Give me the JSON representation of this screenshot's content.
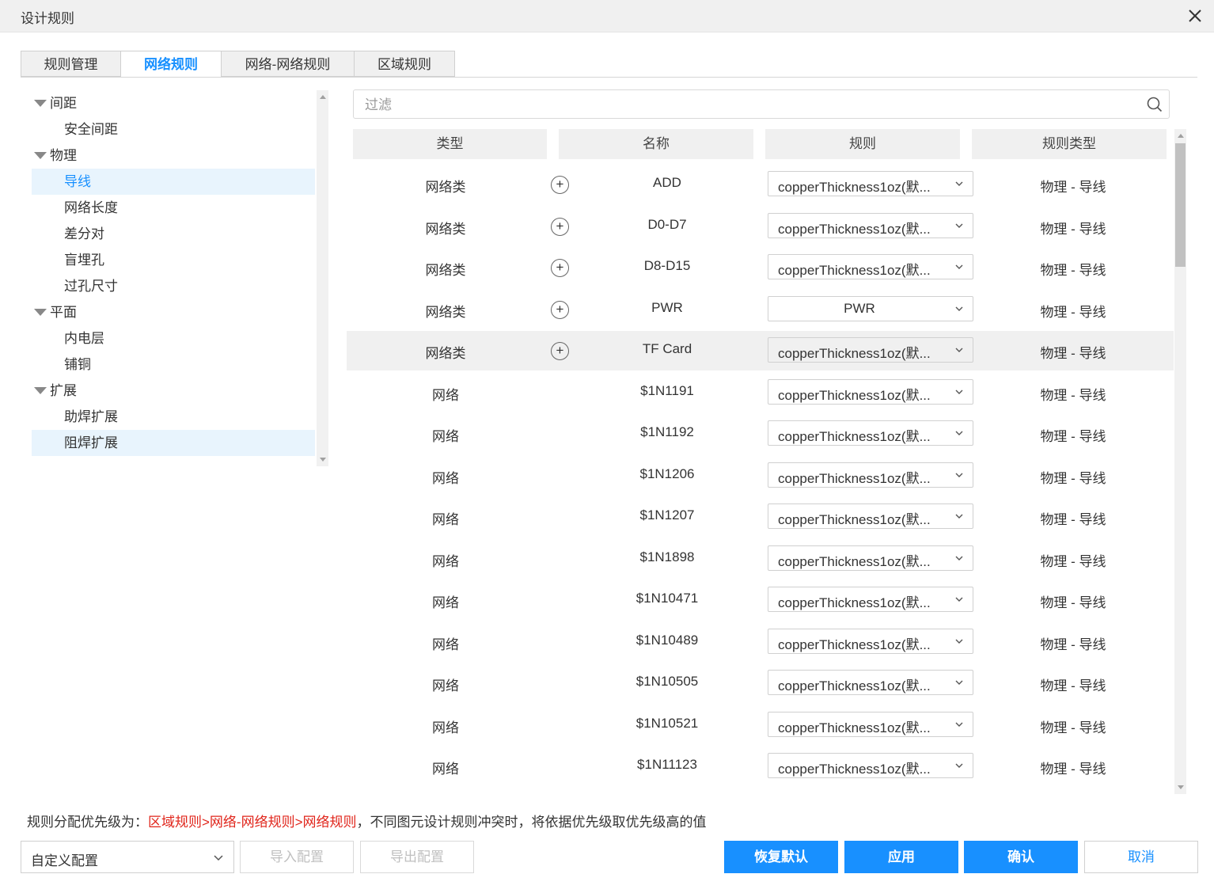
{
  "window": {
    "title": "设计规则"
  },
  "tabs": [
    {
      "label": "规则管理"
    },
    {
      "label": "网络规则"
    },
    {
      "label": "网络-网络规则"
    },
    {
      "label": "区域规则"
    }
  ],
  "tree": {
    "items": [
      {
        "label": "间距"
      },
      {
        "label": "安全间距"
      },
      {
        "label": "物理"
      },
      {
        "label": "导线"
      },
      {
        "label": "网络长度"
      },
      {
        "label": "差分对"
      },
      {
        "label": "盲埋孔"
      },
      {
        "label": "过孔尺寸"
      },
      {
        "label": "平面"
      },
      {
        "label": "内电层"
      },
      {
        "label": "铺铜"
      },
      {
        "label": "扩展"
      },
      {
        "label": "助焊扩展"
      },
      {
        "label": "阻焊扩展"
      }
    ]
  },
  "filter": {
    "placeholder": "过滤",
    "value": ""
  },
  "table": {
    "headers": {
      "type": "类型",
      "name": "名称",
      "rule": "规则",
      "rule_type": "规则类型"
    },
    "rows": [
      {
        "type": "网络类",
        "name": "ADD",
        "rule": "copperThickness1oz(默...",
        "rule_type": "物理 - 导线"
      },
      {
        "type": "网络类",
        "name": "D0-D7",
        "rule": "copperThickness1oz(默...",
        "rule_type": "物理 - 导线"
      },
      {
        "type": "网络类",
        "name": "D8-D15",
        "rule": "copperThickness1oz(默...",
        "rule_type": "物理 - 导线"
      },
      {
        "type": "网络类",
        "name": "PWR",
        "rule": "PWR",
        "rule_type": "物理 - 导线"
      },
      {
        "type": "网络类",
        "name": "TF Card",
        "rule": "copperThickness1oz(默...",
        "rule_type": "物理 - 导线"
      },
      {
        "type": "网络",
        "name": "$1N1191",
        "rule": "copperThickness1oz(默...",
        "rule_type": "物理 - 导线"
      },
      {
        "type": "网络",
        "name": "$1N1192",
        "rule": "copperThickness1oz(默...",
        "rule_type": "物理 - 导线"
      },
      {
        "type": "网络",
        "name": "$1N1206",
        "rule": "copperThickness1oz(默...",
        "rule_type": "物理 - 导线"
      },
      {
        "type": "网络",
        "name": "$1N1207",
        "rule": "copperThickness1oz(默...",
        "rule_type": "物理 - 导线"
      },
      {
        "type": "网络",
        "name": "$1N1898",
        "rule": "copperThickness1oz(默...",
        "rule_type": "物理 - 导线"
      },
      {
        "type": "网络",
        "name": "$1N10471",
        "rule": "copperThickness1oz(默...",
        "rule_type": "物理 - 导线"
      },
      {
        "type": "网络",
        "name": "$1N10489",
        "rule": "copperThickness1oz(默...",
        "rule_type": "物理 - 导线"
      },
      {
        "type": "网络",
        "name": "$1N10505",
        "rule": "copperThickness1oz(默...",
        "rule_type": "物理 - 导线"
      },
      {
        "type": "网络",
        "name": "$1N10521",
        "rule": "copperThickness1oz(默...",
        "rule_type": "物理 - 导线"
      },
      {
        "type": "网络",
        "name": "$1N11123",
        "rule": "copperThickness1oz(默...",
        "rule_type": "物理 - 导线"
      }
    ]
  },
  "footer": {
    "note_prefix": "规则分配优先级为：",
    "note_priority": "区域规则>网络-网络规则>网络规则",
    "note_suffix": "，不同图元设计规则冲突时，将依据优先级取优先级高的值",
    "config_select": "自定义配置",
    "import_label": "导入配置",
    "export_label": "导出配置",
    "restore_label": "恢复默认",
    "apply_label": "应用",
    "confirm_label": "确认",
    "cancel_label": "取消"
  },
  "colors": {
    "accent": "#1890ff",
    "highlight": "#e0241a",
    "selected_bg": "#e8f4fd"
  }
}
